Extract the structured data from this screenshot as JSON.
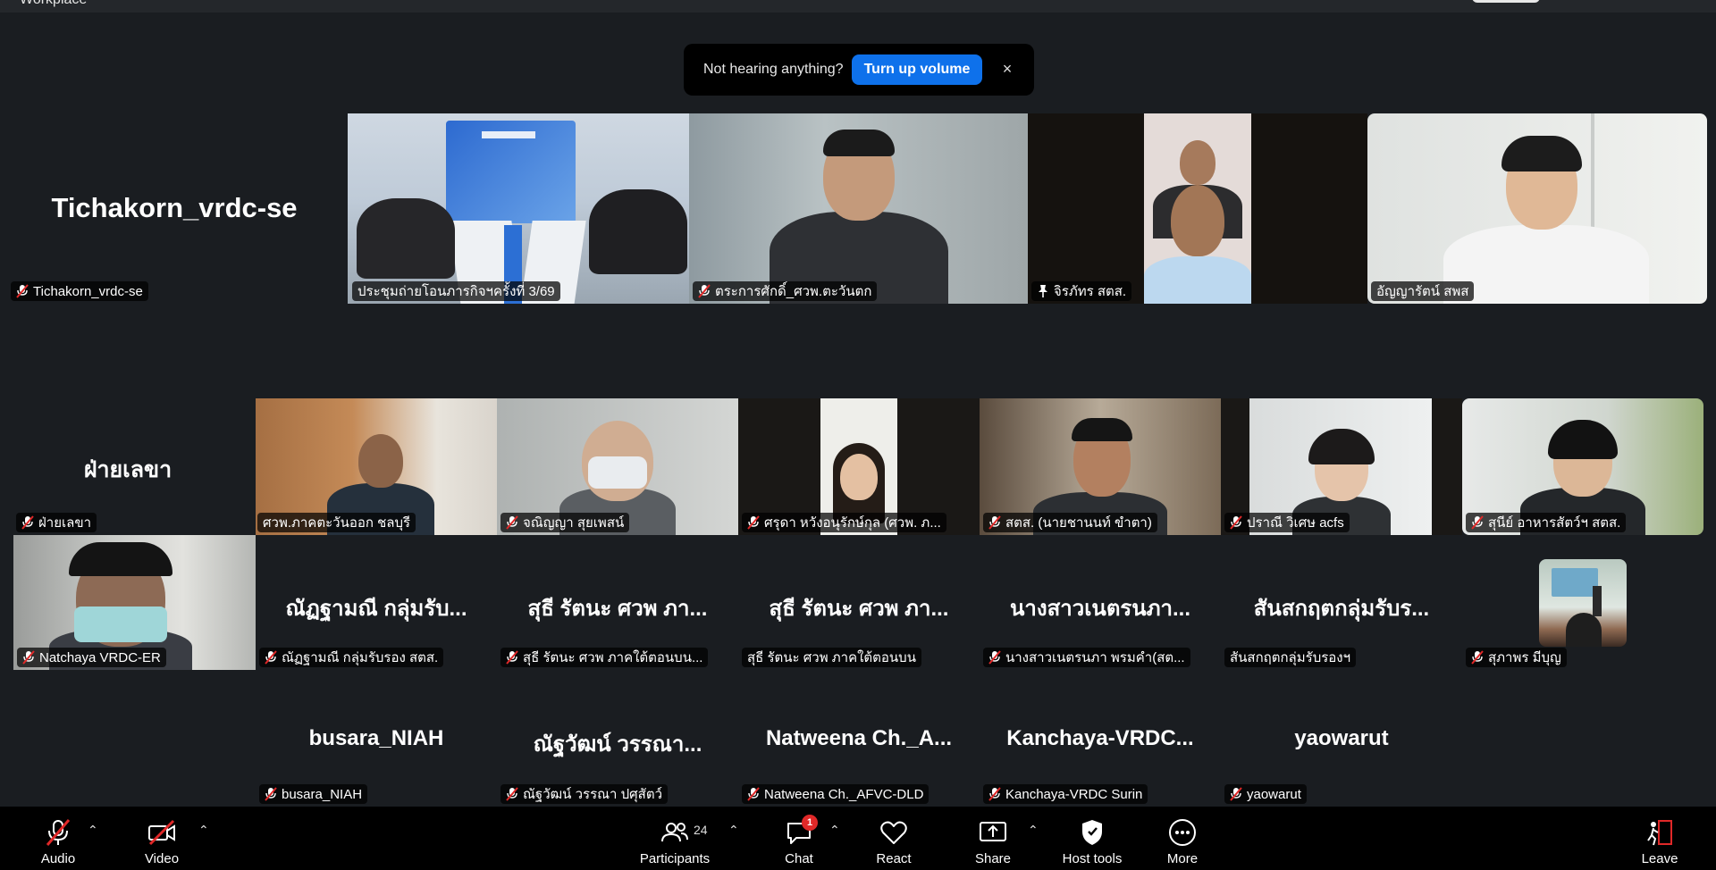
{
  "window": {
    "title": "Workplace"
  },
  "notification": {
    "message": "Not hearing anything?",
    "action_label": "Turn up volume",
    "close_glyph": "×"
  },
  "row1": [
    {
      "id": "t1",
      "type": "name",
      "big_name": "Tichakorn_vrdc-se",
      "label": "Tichakorn_vrdc-se",
      "muted": true
    },
    {
      "id": "t2",
      "type": "video",
      "label": "ประชุมถ่ายโอนภารกิจฯครั้งที่ 3/69",
      "muted": false,
      "active": true
    },
    {
      "id": "t3",
      "type": "video",
      "label": "ตระการศักดิ์_ศวพ.ตะวันตก",
      "muted": true
    },
    {
      "id": "t4",
      "type": "video",
      "label": "จิรภัทร สตส.",
      "muted": false,
      "pinned": true
    },
    {
      "id": "t5",
      "type": "video",
      "label": "อัญญารัตน์ สพส",
      "muted": false
    }
  ],
  "row2": [
    {
      "id": "t6",
      "type": "name",
      "big_name": "ฝ่ายเลขา",
      "label": "ฝ่ายเลขา",
      "muted": true
    },
    {
      "id": "t7",
      "type": "video",
      "label": "ศวพ.ภาคตะวันออก ชลบุรี",
      "muted": false
    },
    {
      "id": "t8",
      "type": "video",
      "label": "จณิญญา สุยเพสน์",
      "muted": true
    },
    {
      "id": "t9",
      "type": "video",
      "label": "ศรุดา หวังอนุรักษ์กุล (ศวพ. ภ...",
      "muted": true
    },
    {
      "id": "t10",
      "type": "video",
      "label": "สตส. (นายชานนท์ ขำตา)",
      "muted": true
    },
    {
      "id": "t11",
      "type": "video",
      "label": "ปราณี วิเศษ acfs",
      "muted": true
    },
    {
      "id": "t12",
      "type": "video",
      "label": "สุนีย์ อาหารสัตว์ฯ สตส.",
      "muted": true
    }
  ],
  "row3": [
    {
      "id": "t13",
      "type": "video",
      "label": "Natchaya VRDC-ER",
      "muted": true
    },
    {
      "id": "t14",
      "type": "name",
      "big_name": "ณัฏฐามณี กลุ่มรับ...",
      "label": "ณัฏฐามณี กลุ่มรับรอง สตส.",
      "muted": true
    },
    {
      "id": "t15",
      "type": "name",
      "big_name": "สุธี รัตนะ ศวพ ภา...",
      "label": "สุธี รัตนะ ศวพ ภาคใต้ตอนบน...",
      "muted": true
    },
    {
      "id": "t16",
      "type": "name",
      "big_name": "สุธี รัตนะ ศวพ ภา...",
      "label": "สุธี รัตนะ ศวพ ภาคใต้ตอนบน",
      "muted": false
    },
    {
      "id": "t17",
      "type": "name",
      "big_name": "นางสาวเนตรนภา...",
      "label": "นางสาวเนตรนภา พรมคำ(สต...",
      "muted": true
    },
    {
      "id": "t18",
      "type": "name",
      "big_name": "สันสกฤตกลุ่มรับร...",
      "label": "สันสกฤตกลุ่มรับรองฯ",
      "muted": false
    },
    {
      "id": "t19",
      "type": "thumb",
      "label": "สุภาพร มีบุญ",
      "muted": true
    }
  ],
  "row4": [
    {
      "id": "t20",
      "type": "name",
      "big_name": "busara_NIAH",
      "label": "busara_NIAH",
      "muted": true
    },
    {
      "id": "t21",
      "type": "name",
      "big_name": "ณัฐวัฒน์ วรรณา...",
      "label": "ณัฐวัฒน์ วรรณา ปศุสัตว์",
      "muted": true
    },
    {
      "id": "t22",
      "type": "name",
      "big_name": "Natweena Ch._A...",
      "label": "Natweena Ch._AFVC-DLD",
      "muted": true
    },
    {
      "id": "t23",
      "type": "name",
      "big_name": "Kanchaya-VRDC...",
      "label": "Kanchaya-VRDC Surin",
      "muted": true
    },
    {
      "id": "t24",
      "type": "name",
      "big_name": "yaowarut",
      "label": "yaowarut",
      "muted": true
    }
  ],
  "toolbar": {
    "audio": "Audio",
    "video": "Video",
    "participants": "Participants",
    "participants_count": "24",
    "chat": "Chat",
    "chat_badge": "1",
    "react": "React",
    "share": "Share",
    "host_tools": "Host tools",
    "more": "More",
    "leave": "Leave"
  },
  "colors": {
    "background": "#1a1d21",
    "active_speaker": "#23d959",
    "primary_button": "#0e71eb",
    "mute_red": "#e02828"
  }
}
